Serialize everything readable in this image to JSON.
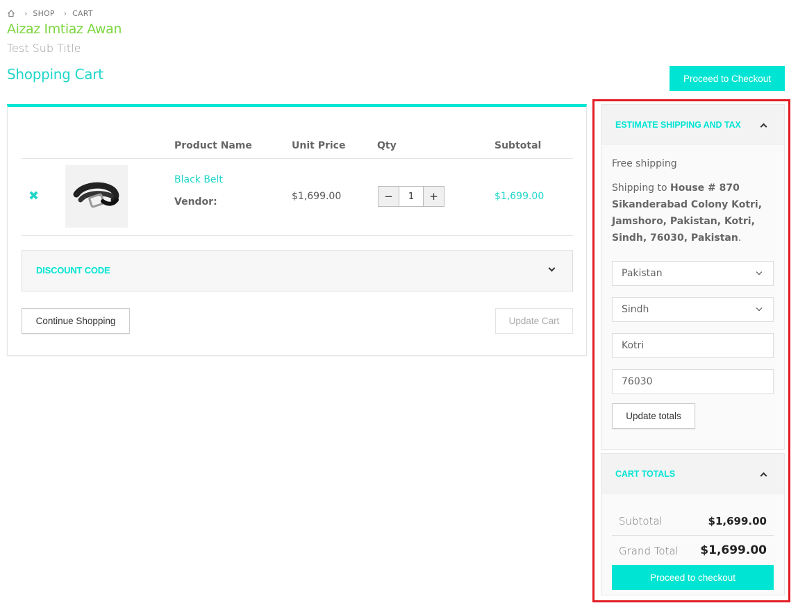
{
  "breadcrumb": {
    "home_icon": "home-icon",
    "items": [
      "SHOP",
      "CART"
    ]
  },
  "store_title": "Aizaz Imtiaz Awan",
  "sub_title": "Test Sub Title",
  "page_title": "Shopping Cart",
  "proceed_top_label": "Proceed to Checkout",
  "cart_table": {
    "headers": {
      "product_name": "Product Name",
      "unit_price": "Unit Price",
      "qty": "Qty",
      "subtotal": "Subtotal"
    },
    "rows": [
      {
        "remove_icon": "close-icon",
        "image": "belt-image",
        "name": "Black Belt",
        "vendor_label": "Vendor:",
        "unit_price": "$1,699.00",
        "qty": "1",
        "minus": "−",
        "plus": "+",
        "subtotal": "$1,699.00"
      }
    ]
  },
  "discount": {
    "label": "DISCOUNT CODE"
  },
  "buttons": {
    "continue": "Continue Shopping",
    "update_cart": "Update Cart"
  },
  "shipping": {
    "header": "ESTIMATE SHIPPING AND TAX",
    "free_shipping": "Free shipping",
    "shipping_to_prefix": "Shipping to ",
    "shipping_address": "House # 870 Sikanderabad Colony Kotri, Jamshoro, Pakistan, Kotri, Sindh, 76030, Pakistan",
    "shipping_suffix": ".",
    "country": "Pakistan",
    "state": "Sindh",
    "city": "Kotri",
    "postcode": "76030",
    "update_totals": "Update totals"
  },
  "totals": {
    "header": "CART TOTALS",
    "subtotal_label": "Subtotal",
    "subtotal_value": "$1,699.00",
    "grand_total_label": "Grand Total",
    "grand_total_value": "$1,699.00",
    "checkout": "Proceed to checkout"
  },
  "colors": {
    "accent": "#00e5d3",
    "store_title": "#7cd63f",
    "highlight": "#e31b23"
  }
}
